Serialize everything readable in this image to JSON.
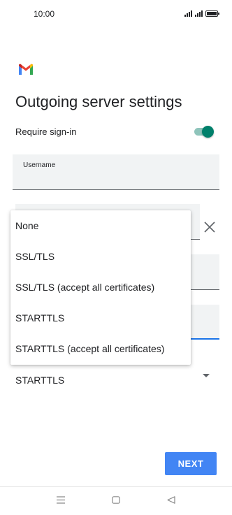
{
  "status_bar": {
    "time": "10:00"
  },
  "header": {
    "title": "Outgoing server settings"
  },
  "require_signin": {
    "label": "Require sign-in",
    "enabled": true
  },
  "username_field": {
    "label": "Username"
  },
  "security_type": {
    "selected": "STARTTLS"
  },
  "security_menu": {
    "options": [
      "None",
      "SSL/TLS",
      "SSL/TLS (accept all certificates)",
      "STARTTLS",
      "STARTTLS (accept all certificates)"
    ]
  },
  "footer": {
    "next_label": "NEXT"
  },
  "colors": {
    "accent": "#00806b",
    "button": "#4285f4",
    "focus_underline": "#1a73e8"
  },
  "icons": {
    "logo": "gmail-logo-icon",
    "close": "close-icon",
    "dropdown": "dropdown-arrow-icon",
    "nav": [
      "recent-apps-icon",
      "home-icon",
      "back-icon"
    ]
  }
}
